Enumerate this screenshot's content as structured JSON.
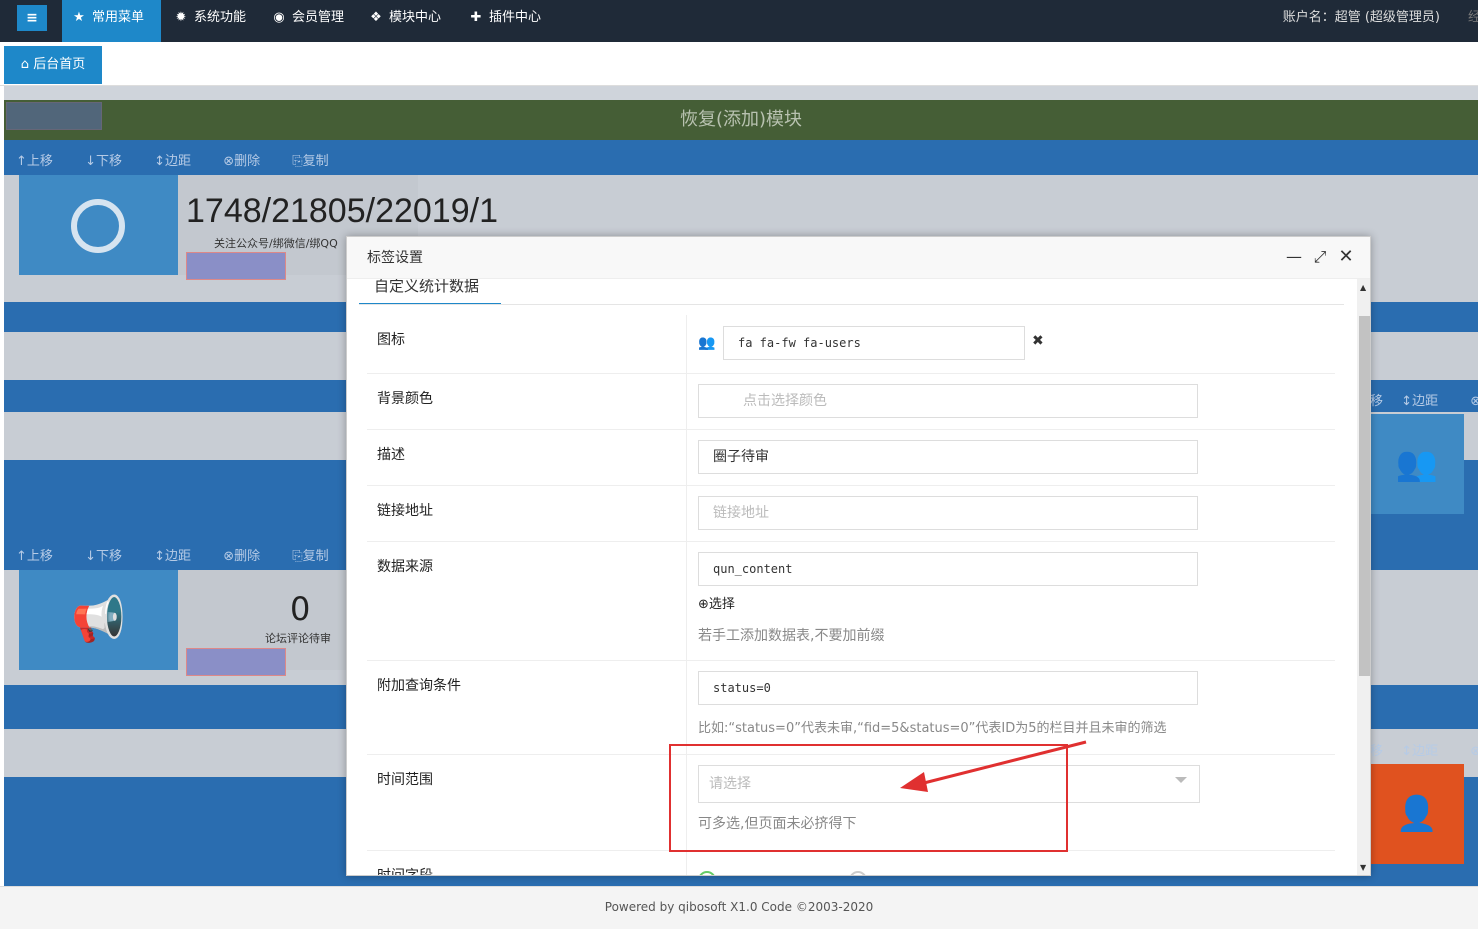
{
  "topbar": {
    "menu_items": [
      {
        "label": "常用菜单",
        "icon": "star-icon"
      },
      {
        "label": "系统功能",
        "icon": "gear-icon"
      },
      {
        "label": "会员管理",
        "icon": "user-circle-icon"
      },
      {
        "label": "模块中心",
        "icon": "cubes-icon"
      },
      {
        "label": "插件中心",
        "icon": "puzzle-icon"
      }
    ],
    "account": "账户名：超管 (超级管理员)",
    "account_trail": "经"
  },
  "tabs": {
    "home_label": "后台首页"
  },
  "background": {
    "restore_title": "恢复(添加)模块",
    "toolbar": [
      "上移",
      "下移",
      "边距",
      "删除",
      "复制"
    ],
    "stat1_value": "1748/21805/22019/1",
    "stat1_desc": "关注公众号/绑微信/绑QQ",
    "stat2_value": "0",
    "stat2_desc": "论坛评论待审",
    "right_toolbar_a": "移",
    "right_toolbar_b": "边距"
  },
  "modal": {
    "title": "标签设置",
    "subtab": "自定义统计数据",
    "fields": {
      "icon_label": "图标",
      "icon_value": "fa fa-fw fa-users",
      "bgcolor_label": "背景颜色",
      "bgcolor_placeholder": "点击选择颜色",
      "desc_label": "描述",
      "desc_value": "圈子待审",
      "link_label": "链接地址",
      "link_placeholder": "链接地址",
      "source_label": "数据来源",
      "source_value": "qun_content",
      "source_select": "选择",
      "source_hint": "若手工添加数据表,不要加前缀",
      "where_label": "附加查询条件",
      "where_value": "status=0",
      "where_hint": "比如:“status=0”代表未审,“fid=5&status=0”代表ID为5的栏目并且未审的筛选",
      "time_label": "时间范围",
      "time_placeholder": "请选择",
      "time_hint": "可多选,但页面未必挤得下",
      "time_field_label": "时间字段"
    }
  },
  "footer": {
    "text": "Powered by  qibosoft X1.0 Code ©2003-2020"
  },
  "colors": {
    "nav_bg": "#1f2a38",
    "accent": "#1e88c9",
    "annotation": "#e03030"
  }
}
